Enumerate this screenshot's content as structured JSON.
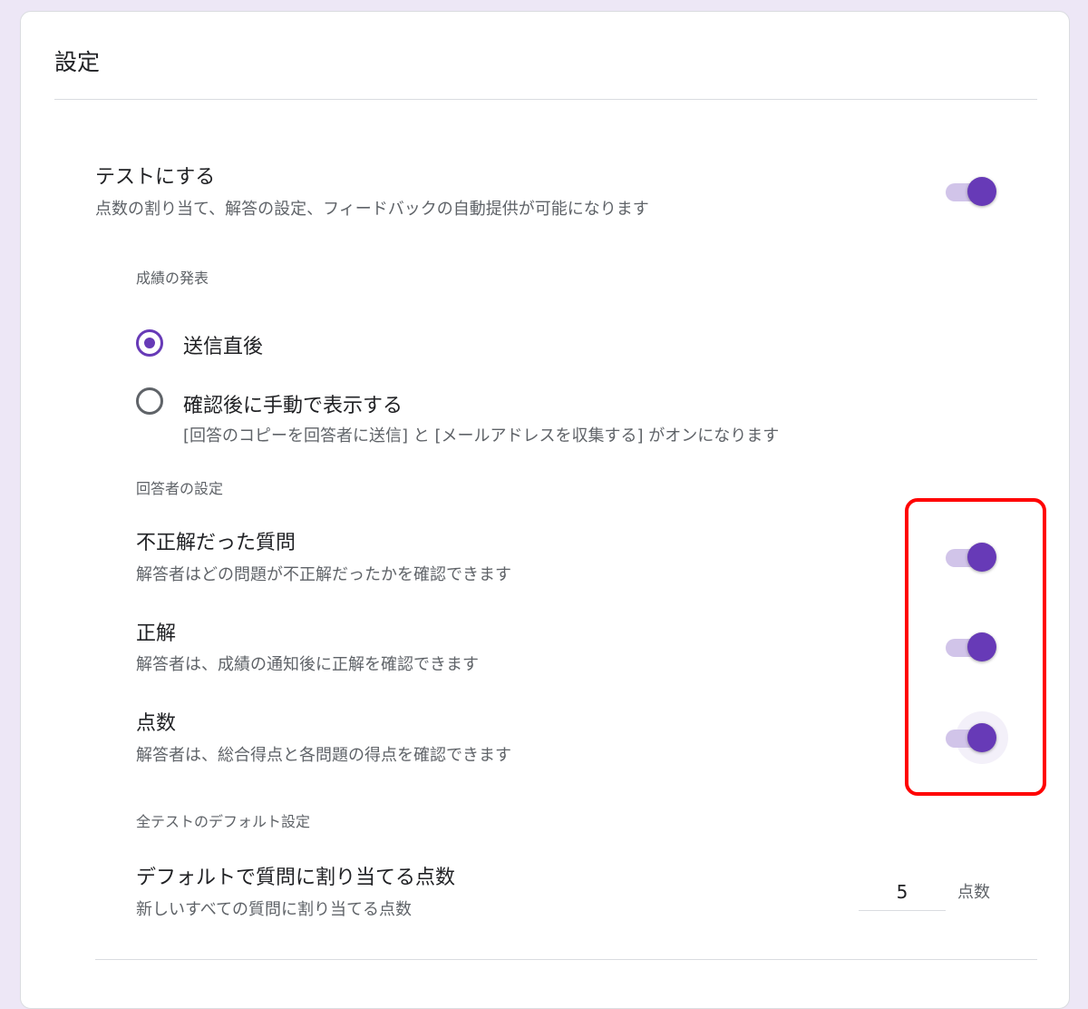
{
  "page_title": "設定",
  "quiz_toggle": {
    "title": "テストにする",
    "description": "点数の割り当て、解答の設定、フィードバックの自動提供が可能になります",
    "on": true
  },
  "grade_release": {
    "label": "成績の発表",
    "options": [
      {
        "label": "送信直後",
        "description": "",
        "selected": true
      },
      {
        "label": "確認後に手動で表示する",
        "description": "[回答のコピーを回答者に送信] と [メールアドレスを収集する] がオンになります",
        "selected": false
      }
    ]
  },
  "respondent_settings": {
    "label": "回答者の設定",
    "items": [
      {
        "title": "不正解だった質問",
        "description": "解答者はどの問題が不正解だったかを確認できます",
        "on": true
      },
      {
        "title": "正解",
        "description": "解答者は、成績の通知後に正解を確認できます",
        "on": true
      },
      {
        "title": "点数",
        "description": "解答者は、総合得点と各問題の得点を確認できます",
        "on": true
      }
    ]
  },
  "quiz_defaults": {
    "label": "全テストのデフォルト設定",
    "title": "デフォルトで質問に割り当てる点数",
    "description": "新しいすべての質問に割り当てる点数",
    "value": "5",
    "unit": "点数"
  },
  "colors": {
    "accent": "#673ab7",
    "track": "#d1c4e9",
    "highlight": "#ff0000",
    "background": "#ede7f6"
  }
}
